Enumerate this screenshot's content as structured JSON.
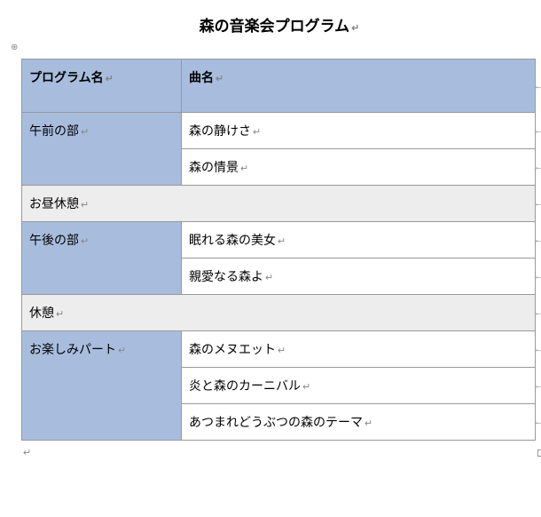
{
  "title": "森の音楽会プログラム",
  "headers": {
    "program": "プログラム名",
    "song": "曲名"
  },
  "sections": [
    {
      "type": "program",
      "name": "午前の部",
      "songs": [
        "森の静けさ",
        "森の情景"
      ]
    },
    {
      "type": "break",
      "label": "お昼休憩"
    },
    {
      "type": "program",
      "name": "午後の部",
      "songs": [
        "眠れる森の美女",
        "親愛なる森よ"
      ]
    },
    {
      "type": "break",
      "label": "休憩"
    },
    {
      "type": "program",
      "name": "お楽しみパート",
      "songs": [
        "森のメヌエット",
        "炎と森のカーニバル",
        "あつまれどうぶつの森のテーマ"
      ]
    }
  ],
  "marks": {
    "return": "↵",
    "rowend": "←",
    "anchor": "⊕"
  }
}
